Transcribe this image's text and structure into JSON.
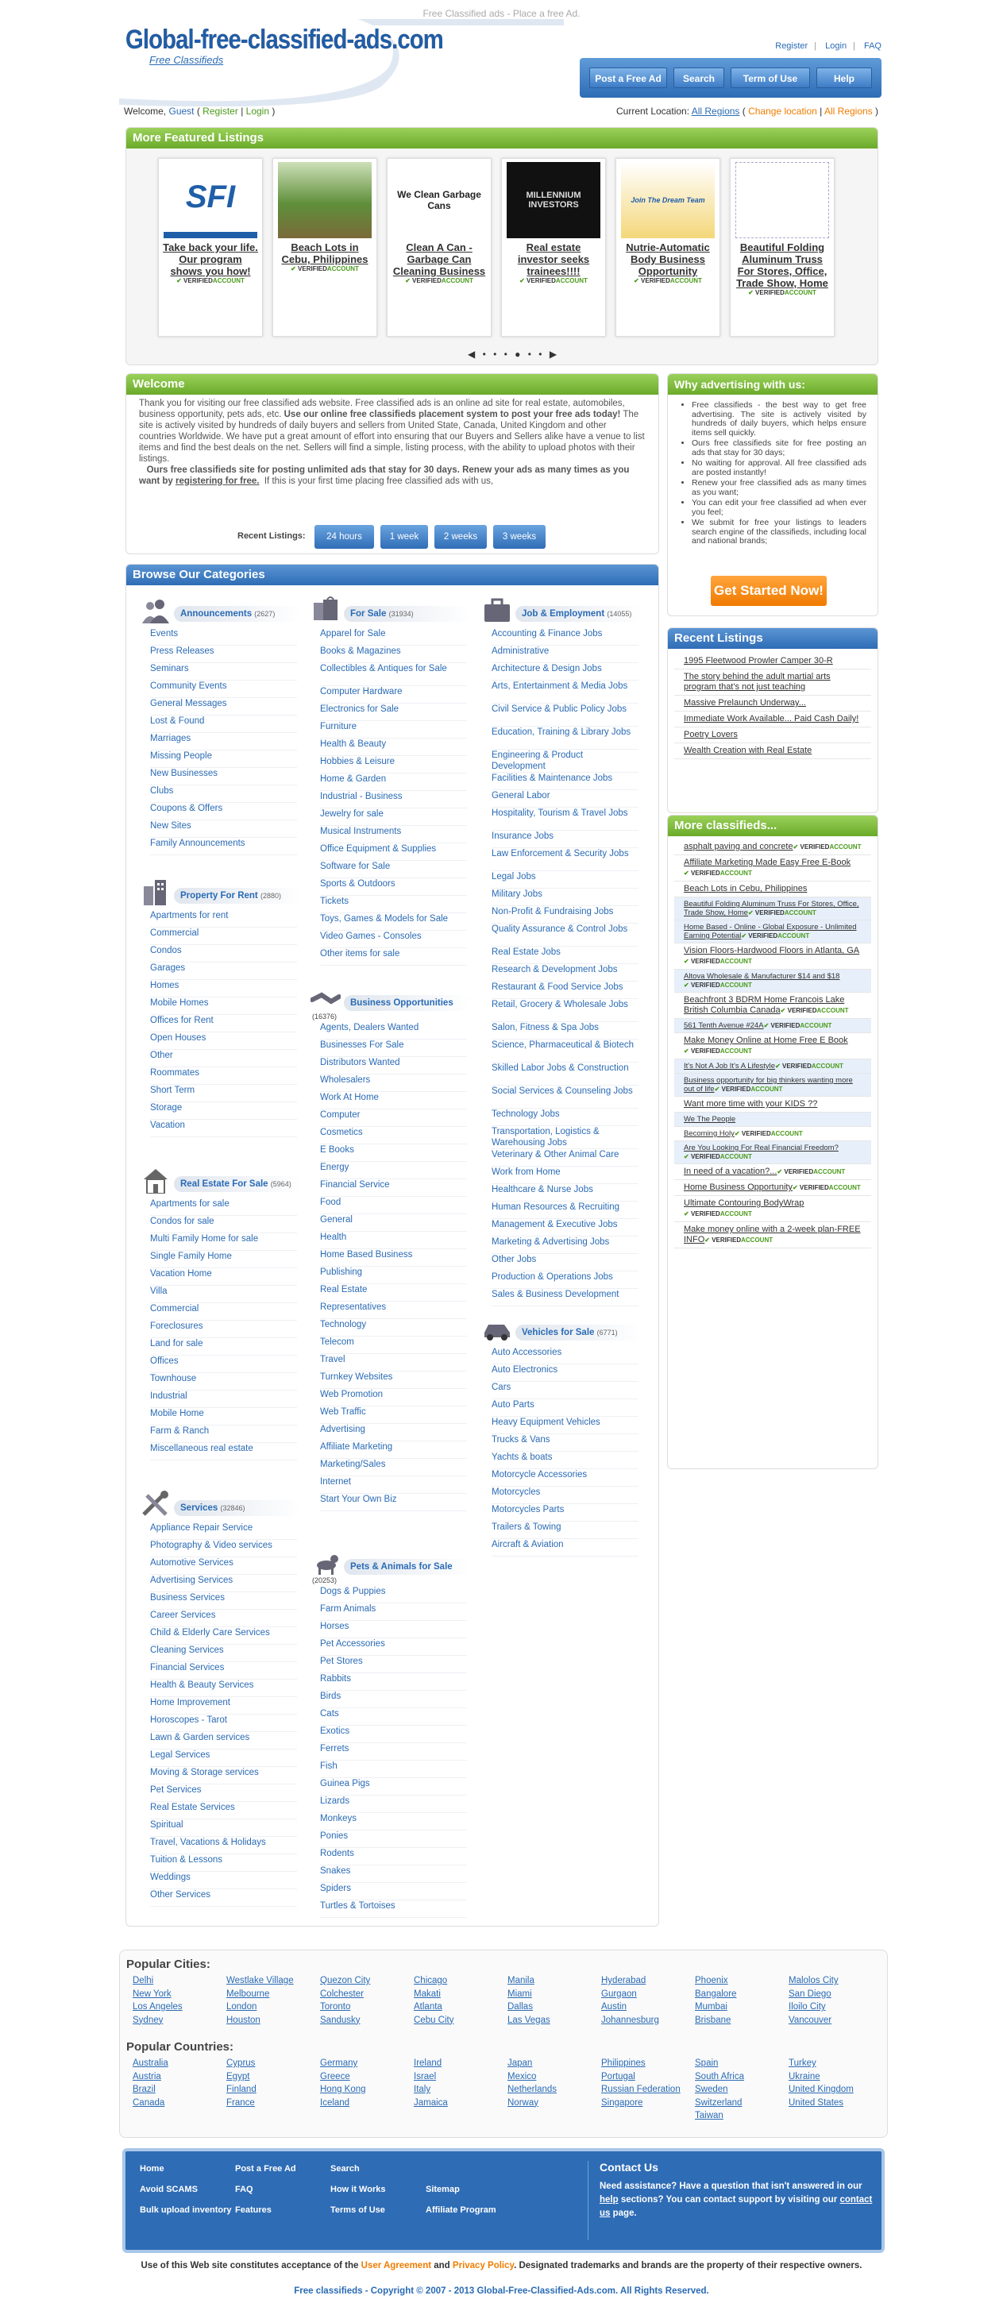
{
  "tagline": "Free Classified ads - Place a free Ad.",
  "logo": {
    "name_a": "Global-",
    "name_b": "free",
    "name_c": "-classified-ads",
    "name_d": ".com",
    "sub": "Free Classifieds"
  },
  "toplinks": {
    "register": "Register",
    "login": "Login",
    "faq": "FAQ"
  },
  "nav": {
    "post": "Post a Free Ad",
    "search": "Search",
    "terms": "Term of Use",
    "help": "Help"
  },
  "welcomebar": {
    "welcome": "Welcome,",
    "guest": "Guest",
    "register": "Register",
    "login": "Login",
    "loc_label": "Current Location:",
    "loc_value": "All Regions",
    "change": "Change location",
    "all": "All Regions"
  },
  "featured": {
    "title": "More Featured Listings",
    "pager": "◀ • • • ● • • ▶",
    "cards": [
      {
        "title": "Take back your life. Our program shows you how!",
        "logo": "SFI"
      },
      {
        "title": "Beach Lots in Cebu, Philippines",
        "logo": ""
      },
      {
        "title": "Clean A Can - Garbage Can Cleaning Business",
        "logo": "We Clean Garbage Cans"
      },
      {
        "title": "Real estate investor seeks trainees!!!!",
        "logo": "MILLENNIUM INVESTORS"
      },
      {
        "title": "Nutrie-Automatic Body Business Opportunity",
        "logo": "Join The Dream Team"
      },
      {
        "title": "Beautiful Folding Aluminum Truss For Stores, Office, Trade Show, Home",
        "logo": ""
      }
    ],
    "verified_label": "VERIFIED",
    "account_label": "ACCOUNT"
  },
  "welcome": {
    "title": "Welcome",
    "p1a": "Thank you for visiting our free classified ads website. Free classified ads is an online ad site for real estate, automobiles, business opportunity, pets ads, etc.",
    "p1b": "Use our online free classifieds placement system to post your free ads today!",
    "p1c": "The site is actively visited by hundreds of daily buyers and sellers from United State, Canada, United Kingdom and other countries Worldwide. We have put a great amount of effort into ensuring that our Buyers and Sellers alike have a venue to list items and find the best deals on the net. Sellers will find a simple, listing process, with the ability to upload photos with their listings.",
    "p2a": "Ours free classifieds site for posting unlimited ads that stay for 30 days. Renew your ads as many times as you want by",
    "p2link": "registering for free.",
    "p2b": "If this is your first time placing free classified ads with us,",
    "recent_label": "Recent Listings:",
    "btns": [
      "24 hours",
      "1 week",
      "2 weeks",
      "3 weeks"
    ]
  },
  "why": {
    "title": "Why advertising with us:",
    "items": [
      "Free classifieds - the best way to get free advertising. The site is actively visited by hundreds of daily buyers, which helps ensure items sell quickly.",
      "Ours free classifieds site for free posting an ads that stay for 30 days;",
      "No waiting for approval. All free classified ads are posted instantly!",
      "Renew your free classified ads as many times as you want;",
      "You can edit your free classified ad when ever you feel;",
      "We submit for free your listings to leaders search engine of the classifieds, including local and national brands;"
    ],
    "cta": "Get Started Now!"
  },
  "browse": {
    "title": "Browse Our Categories",
    "announcements": {
      "title": "Announcements",
      "count": "(2627)",
      "items": [
        "Events",
        "Press Releases",
        "Seminars",
        "Community Events",
        "General Messages",
        "Lost & Found",
        "Marriages",
        "Missing People",
        "New Businesses",
        "Clubs",
        "Coupons & Offers",
        "New Sites",
        "Family Announcements"
      ]
    },
    "forrent": {
      "title": "Property For Rent",
      "count": "(2880)",
      "items": [
        "Apartments for rent",
        "Commercial",
        "Condos",
        "Garages",
        "Homes",
        "Mobile Homes",
        "Offices for Rent",
        "Open Houses",
        "Other",
        "Roommates",
        "Short Term",
        "Storage",
        "Vacation"
      ]
    },
    "realestate": {
      "title": "Real Estate For Sale",
      "count": "(5964)",
      "items": [
        "Apartments for sale",
        "Condos for sale",
        "Multi Family Home for sale",
        "Single Family Home",
        "Vacation Home",
        "Villa",
        "Commercial",
        "Foreclosures",
        "Land for sale",
        "Offices",
        "Townhouse",
        "Industrial",
        "Mobile Home",
        "Farm & Ranch",
        "Miscellaneous real estate"
      ]
    },
    "services": {
      "title": "Services",
      "count": "(32846)",
      "items": [
        "Appliance Repair Service",
        "Photography & Video services",
        "Automotive Services",
        "Advertising Services",
        "Business Services",
        "Career Services",
        "Child & Elderly Care Services",
        "Cleaning Services",
        "Financial Services",
        "Health & Beauty Services",
        "Home Improvement",
        "Horoscopes - Tarot",
        "Lawn & Garden services",
        "Legal Services",
        "Moving & Storage services",
        "Pet Services",
        "Real Estate Services",
        "Spiritual",
        "Travel, Vacations & Holidays",
        "Tuition & Lessons",
        "Weddings",
        "Other Services"
      ]
    },
    "forsale": {
      "title": "For Sale",
      "count": "(31934)",
      "items": [
        "Apparel for Sale",
        "Books & Magazines",
        "Collectibles & Antiques for Sale",
        "Computer Hardware",
        "Electronics for Sale",
        "Furniture",
        "Health & Beauty",
        "Hobbies & Leisure",
        "Home & Garden",
        "Industrial - Business",
        "Jewelry for sale",
        "Musical Instruments",
        "Office Equipment & Supplies",
        "Software for Sale",
        "Sports & Outdoors",
        "Tickets",
        "Toys, Games & Models for Sale",
        "Video Games - Consoles",
        "Other items for sale"
      ]
    },
    "bizopp": {
      "title": "Business Opportunities",
      "count": "(16376)",
      "items": [
        "Agents, Dealers Wanted",
        "Businesses For Sale",
        "Distributors Wanted",
        "Wholesalers",
        "Work At Home",
        "Computer",
        "Cosmetics",
        "E Books",
        "Energy",
        "Financial Service",
        "Food",
        "General",
        "Health",
        "Home Based Business",
        "Publishing",
        "Real Estate",
        "Representatives",
        "Technology",
        "Telecom",
        "Travel",
        "Turnkey Websites",
        "Web Promotion",
        "Web Traffic",
        "Advertising",
        "Affiliate Marketing",
        "Marketing/Sales",
        "Internet",
        "Start Your Own Biz"
      ]
    },
    "pets": {
      "title": "Pets & Animals for Sale",
      "count": "(20253)",
      "items": [
        "Dogs & Puppies",
        "Farm Animals",
        "Horses",
        "Pet Accessories",
        "Pet Stores",
        "Rabbits",
        "Birds",
        "Cats",
        "Exotics",
        "Ferrets",
        "Fish",
        "Guinea Pigs",
        "Lizards",
        "Monkeys",
        "Ponies",
        "Rodents",
        "Snakes",
        "Spiders",
        "Turtles & Tortoises"
      ]
    },
    "jobs": {
      "title": "Job & Employment",
      "count": "(14055)",
      "items": [
        "Accounting & Finance Jobs",
        "Administrative",
        "Architecture & Design Jobs",
        "Arts, Entertainment & Media Jobs",
        "Civil Service & Public Policy Jobs",
        "Education, Training & Library Jobs",
        "Engineering & Product Development",
        "Facilities & Maintenance Jobs",
        "General Labor",
        "Hospitality, Tourism & Travel Jobs",
        "Insurance Jobs",
        "Law Enforcement & Security Jobs",
        "Legal Jobs",
        "Military Jobs",
        "Non-Profit & Fundraising Jobs",
        "Quality Assurance & Control Jobs",
        "Real Estate Jobs",
        "Research & Development Jobs",
        "Restaurant & Food Service Jobs",
        "Retail, Grocery & Wholesale Jobs",
        "Salon, Fitness & Spa Jobs",
        "Science, Pharmaceutical & Biotech",
        "Skilled Labor Jobs & Construction",
        "Social Services & Counseling Jobs",
        "Technology Jobs",
        "Transportation, Logistics & Warehousing Jobs",
        "Veterinary & Other Animal Care",
        "Work from Home",
        "Healthcare & Nurse Jobs",
        "Human Resources & Recruiting",
        "Management & Executive Jobs",
        "Marketing & Advertising Jobs",
        "Other Jobs",
        "Production & Operations Jobs",
        "Sales & Business Development"
      ]
    },
    "vehicles": {
      "title": "Vehicles for Sale",
      "count": "(6771)",
      "items": [
        "Auto Accessories",
        "Auto Electronics",
        "Cars",
        "Auto Parts",
        "Heavy Equipment Vehicles",
        "Trucks & Vans",
        "Yachts & boats",
        "Motorcycle Accessories",
        "Motorcycles",
        "Motorcycles Parts",
        "Trailers & Towing",
        "Aircraft & Aviation"
      ]
    }
  },
  "recent": {
    "title": "Recent Listings",
    "items": [
      "1995 Fleetwood Prowler Camper 30-R",
      "The story behind the adult martial arts program that's not just teaching",
      "Massive Prelaunch Underway...",
      "Immediate Work Available... Paid Cash Daily!",
      "Poetry Lovers",
      "Wealth Creation with Real Estate"
    ]
  },
  "more": {
    "title": "More classifieds...",
    "items": [
      {
        "t": "asphalt paving and concrete",
        "v": true,
        "alt": false,
        "sm": false
      },
      {
        "t": "Affiliate Marketing Made Easy Free E-Book",
        "v": true,
        "alt": false,
        "sm": false
      },
      {
        "t": "Beach Lots in Cebu, Philippines",
        "v": false,
        "alt": false,
        "sm": false
      },
      {
        "t": "Beautiful Folding Aluminum Truss For Stores, Office, Trade Show, Home",
        "v": true,
        "alt": true,
        "sm": true
      },
      {
        "t": "Home Based - Online - Global Exposure - Unlimited Earning Potential",
        "v": true,
        "alt": true,
        "sm": true
      },
      {
        "t": "Vision Floors-Hardwood Floors in Atlanta, GA",
        "v": true,
        "alt": false,
        "sm": false
      },
      {
        "t": "Altova Wholesale & Manufacturer $14 and $18",
        "v": true,
        "alt": true,
        "sm": true
      },
      {
        "t": "Beachfront 3 BDRM Home Francois Lake British Columbia Canada",
        "v": true,
        "alt": false,
        "sm": false
      },
      {
        "t": "561 Tenth Avenue #24A",
        "v": true,
        "alt": true,
        "sm": true
      },
      {
        "t": "Make Money Online at Home Free E Book",
        "v": true,
        "alt": false,
        "sm": false
      },
      {
        "t": "It's Not A Job It's A Lifestyle",
        "v": true,
        "alt": true,
        "sm": true
      },
      {
        "t": "Business opportunity for big thinkers wanting more out of life",
        "v": true,
        "alt": true,
        "sm": true
      },
      {
        "t": "Want more time with your KIDS ??",
        "v": false,
        "alt": false,
        "sm": false
      },
      {
        "t": "We The People",
        "v": false,
        "alt": true,
        "sm": true
      },
      {
        "t": "Becoming Holy",
        "v": true,
        "alt": false,
        "sm": true
      },
      {
        "t": "Are You Looking For Real Financial Freedom?",
        "v": true,
        "alt": true,
        "sm": true
      },
      {
        "t": "In need of a vacation?...",
        "v": true,
        "alt": false,
        "sm": false
      },
      {
        "t": "Home Business Opportunity",
        "v": true,
        "alt": false,
        "sm": false
      },
      {
        "t": "Ultimate Contouring BodyWrap",
        "v": true,
        "alt": false,
        "sm": false
      },
      {
        "t": "Make money online with a 2-week plan-FREE INFO",
        "v": true,
        "alt": false,
        "sm": false
      }
    ]
  },
  "popular": {
    "cities_title": "Popular Cities:",
    "countries_title": "Popular Countries:",
    "cities": [
      [
        "Delhi",
        "New York",
        "Los Angeles",
        "Sydney"
      ],
      [
        "Westlake Village",
        "Melbourne",
        "London",
        "Houston"
      ],
      [
        "Quezon City",
        "Colchester",
        "Toronto",
        "Sandusky"
      ],
      [
        "Chicago",
        "Makati",
        "Atlanta",
        "Cebu City"
      ],
      [
        "Manila",
        "Miami",
        "Dallas",
        "Las Vegas"
      ],
      [
        "Hyderabad",
        "Gurgaon",
        "Austin",
        "Johannesburg"
      ],
      [
        "Phoenix",
        "Bangalore",
        "Mumbai",
        "Brisbane"
      ],
      [
        "Malolos City",
        "San Diego",
        "Iloilo City",
        "Vancouver"
      ]
    ],
    "countries": [
      [
        "Australia",
        "Austria",
        "Brazil",
        "Canada"
      ],
      [
        "Cyprus",
        "Egypt",
        "Finland",
        "France"
      ],
      [
        "Germany",
        "Greece",
        "Hong Kong",
        "Iceland"
      ],
      [
        "Ireland",
        "Israel",
        "Italy",
        "Jamaica"
      ],
      [
        "Japan",
        "Mexico",
        "Netherlands",
        "Norway"
      ],
      [
        "Philippines",
        "Portugal",
        "Russian Federation",
        "Singapore"
      ],
      [
        "Spain",
        "South Africa",
        "Sweden",
        "Switzerland",
        "Taiwan"
      ],
      [
        "Turkey",
        "Ukraine",
        "United Kingdom",
        "United States"
      ]
    ]
  },
  "footer": {
    "cols": [
      [
        "Home",
        "Avoid SCAMS",
        "Bulk upload inventory"
      ],
      [
        "Post a Free Ad",
        "FAQ",
        "Features"
      ],
      [
        "Search",
        "How it Works",
        "Terms of Use"
      ],
      [
        "",
        "Sitemap",
        "Affiliate Program"
      ]
    ],
    "contact_title": "Contact Us",
    "contact_a": "Need assistance? Have a question that isn't answered in our",
    "help": "help",
    "contact_b": "sections? You can contact support by visiting our",
    "contact_link": "contact us",
    "contact_c": "page."
  },
  "legal": {
    "a": "Use of this Web site constitutes acceptance of the",
    "ua": "User Agreement",
    "and": "and",
    "pp": "Privacy Policy",
    "b": ". Designated trademarks and brands are the property of their respective owners."
  },
  "copyright": "Free classifieds - Copyright © 2007 - 2013 Global-Free-Classified-Ads.com. All Rights Reserved."
}
